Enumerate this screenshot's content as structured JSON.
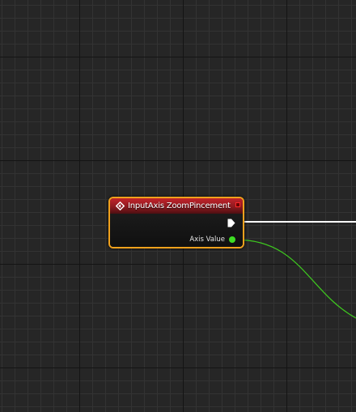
{
  "graph": {
    "event_node": {
      "title": "InputAxis ZoomPincement",
      "icon": "event-diamond-icon",
      "header_color": "#b11d24",
      "border_color": "#f0a11d",
      "output_pins": [
        {
          "label": "",
          "type": "exec",
          "color": "#ffffff"
        },
        {
          "label": "Axis Value",
          "type": "float",
          "color": "#3ede24"
        }
      ]
    },
    "wires": [
      {
        "from_pin": "exec",
        "color": "#ffffff"
      },
      {
        "from_pin": "Axis Value",
        "color": "#3ec91f"
      }
    ]
  }
}
